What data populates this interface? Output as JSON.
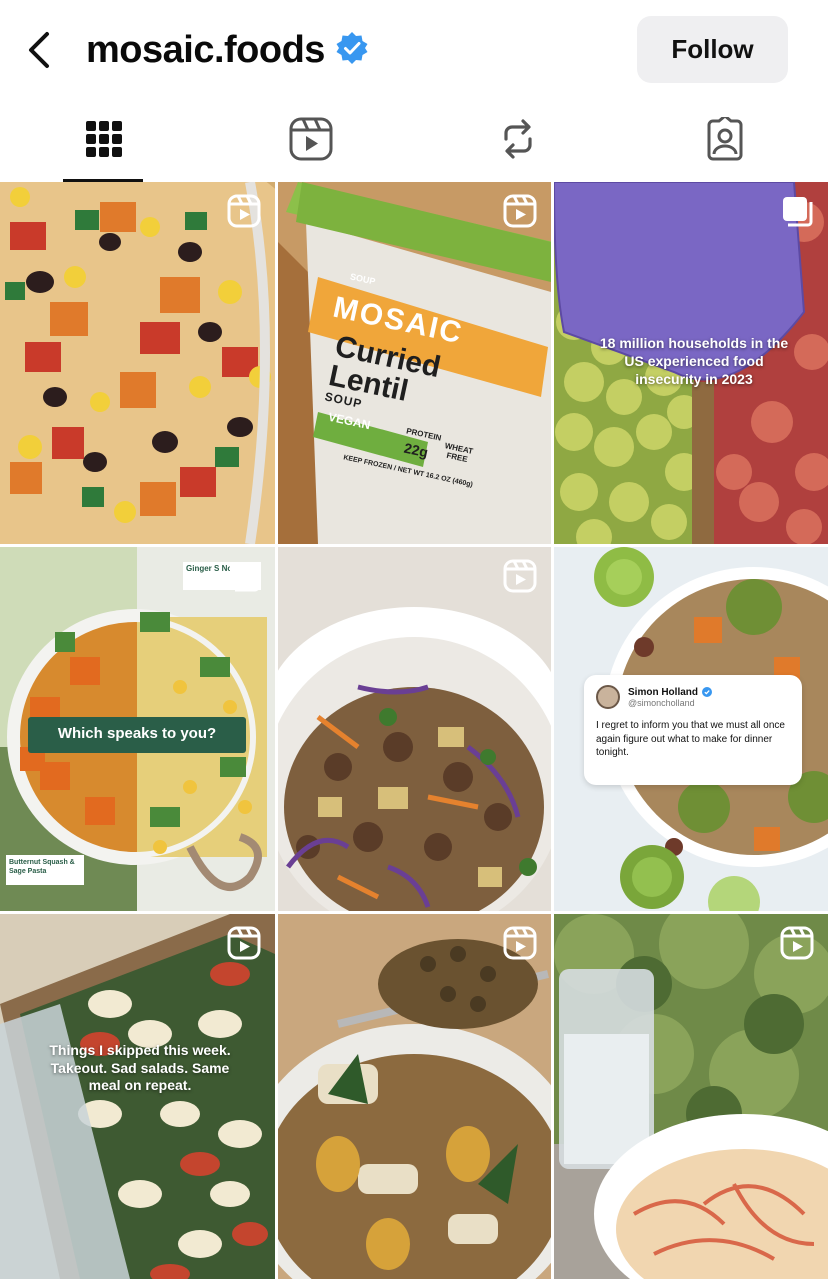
{
  "header": {
    "title": "mosaic.foods",
    "follow_label": "Follow",
    "verified_color": "#3897f0"
  },
  "tabs": [
    {
      "icon": "grid-icon",
      "active": true
    },
    {
      "icon": "reels-icon",
      "active": false
    },
    {
      "icon": "reposts-icon",
      "active": false
    },
    {
      "icon": "tagged-icon",
      "active": false
    }
  ],
  "posts": [
    {
      "type": "reel",
      "image": "burrito-bowl"
    },
    {
      "type": "reel",
      "image": "soup-cup",
      "cup": {
        "brand_small": "SOUP",
        "brand": "MOSAIC",
        "name_line1": "Curried",
        "name_line2": "Lentil",
        "name_line3": "SOUP",
        "vegan": "VEGAN",
        "protein_label": "PROTEIN",
        "protein_value": "22g",
        "wheat_free": "WHEAT FREE",
        "footer": "KEEP FROZEN / NET WT 16.2 OZ (460g)"
      }
    },
    {
      "type": "carousel",
      "image": "produce-market",
      "caption": "18 million households in the US experienced food insecurity in 2023"
    },
    {
      "type": "carousel",
      "image": "split-bowls",
      "label_top": "Ginger S Noo",
      "question": "Which speaks to you?",
      "label_bottom": "Butternut Squash & Sage Pasta"
    },
    {
      "type": "reel",
      "image": "grain-bowl"
    },
    {
      "type": "none",
      "image": "sprout-bowl",
      "tweet": {
        "name": "Simon Holland",
        "handle": "@simoncholland",
        "text": "I regret to inform you that we must all once again figure out what to make for dinner tonight."
      }
    },
    {
      "type": "reel",
      "image": "pasta-tray",
      "caption": "Things I skipped this week. Takeout. Sad salads. Same meal on repeat."
    },
    {
      "type": "reel",
      "image": "lentil-fork"
    },
    {
      "type": "reel",
      "image": "noodles-outdoors"
    }
  ]
}
